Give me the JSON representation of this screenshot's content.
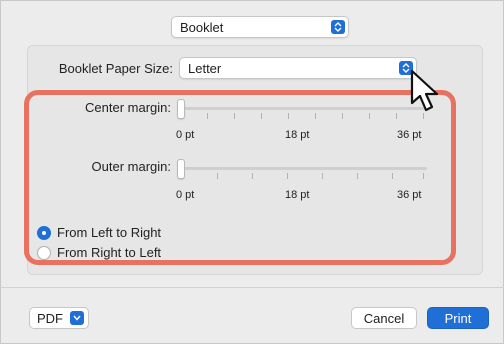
{
  "header": {
    "section_select": "Booklet"
  },
  "paper_size": {
    "label": "Booklet Paper Size:",
    "value": "Letter"
  },
  "center_margin": {
    "label": "Center margin:",
    "ticks": [
      "0 pt",
      "18 pt",
      "36 pt"
    ],
    "value_pt": 0
  },
  "outer_margin": {
    "label": "Outer margin:",
    "ticks": [
      "0 pt",
      "18 pt",
      "36 pt"
    ],
    "value_pt": 0
  },
  "direction": {
    "options": [
      {
        "label": "From Left to Right",
        "selected": true
      },
      {
        "label": "From Right to Left",
        "selected": false
      }
    ]
  },
  "footer": {
    "pdf_label": "PDF",
    "cancel_label": "Cancel",
    "print_label": "Print"
  },
  "colors": {
    "accent": "#1f6fd6",
    "highlight": "#e8725f"
  }
}
